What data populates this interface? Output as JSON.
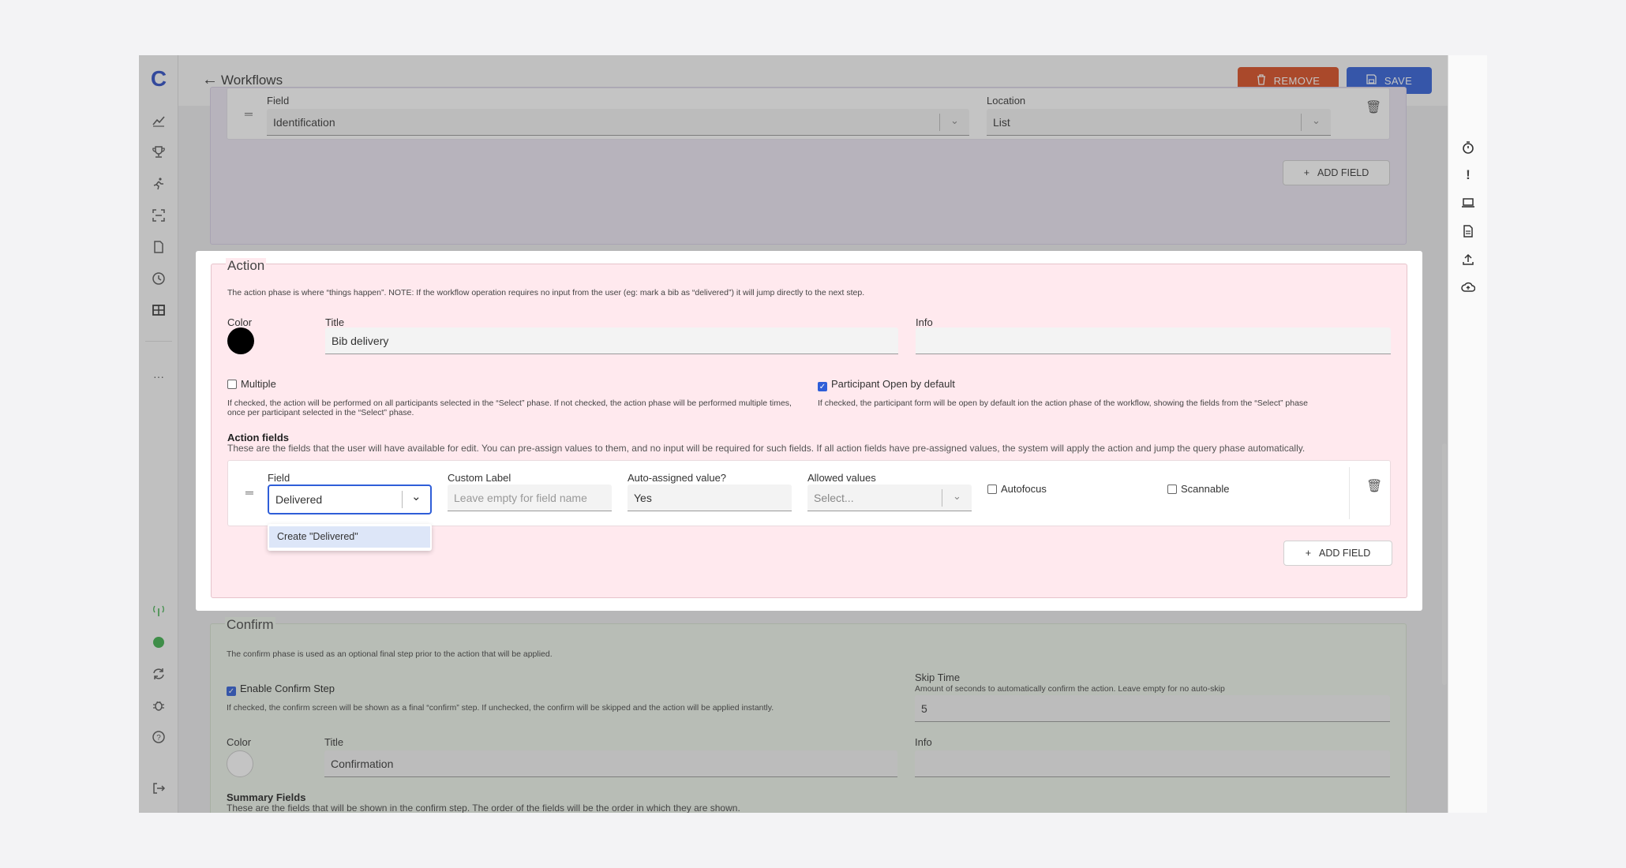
{
  "header": {
    "title": "Workflows",
    "remove_label": "REMOVE",
    "save_label": "SAVE"
  },
  "nav": {
    "logo": "C",
    "more": "···"
  },
  "select_phase": {
    "field_label": "Field",
    "field_value": "Identification",
    "location_label": "Location",
    "location_value": "List",
    "add_field_label": "ADD FIELD"
  },
  "action": {
    "legend": "Action",
    "description": "The action phase is where “things happen”. NOTE: If the workflow operation requires no input from the user (eg: mark a bib as “delivered”) it will jump directly to the next step.",
    "color_label": "Color",
    "color_value": "#000000",
    "title_label": "Title",
    "title_value": "Bib delivery",
    "info_label": "Info",
    "info_value": "",
    "multiple_label": "Multiple",
    "multiple_checked": false,
    "multiple_help": "If checked, the action will be performed on all participants selected in the “Select” phase. If not checked, the action phase will be performed multiple times, once per participant selected in the “Select” phase.",
    "participant_label": "Participant Open by default",
    "participant_checked": true,
    "participant_help": "If checked, the participant form will be open by default ion the action phase of the workflow, showing the fields from the “Select” phase",
    "fields_heading": "Action fields",
    "fields_help": "These are the fields that the user will have available for edit. You can pre-assign values to them, and no input will be required for such fields. If all action fields have pre-assigned values, the system will apply the action and jump the query phase automatically.",
    "row": {
      "field_label": "Field",
      "field_value": "Delivered",
      "custom_label": "Custom Label",
      "custom_placeholder": "Leave empty for field name",
      "auto_label": "Auto-assigned value?",
      "auto_value": "Yes",
      "allowed_label": "Allowed values",
      "allowed_placeholder": "Select...",
      "autofocus_label": "Autofocus",
      "scannable_label": "Scannable"
    },
    "dropdown_option": "Create \"Delivered\"",
    "add_field_label": "ADD FIELD"
  },
  "confirm": {
    "legend": "Confirm",
    "description": "The confirm phase is used as an optional final step prior to the action that will be applied.",
    "enable_label": "Enable Confirm Step",
    "enable_checked": true,
    "enable_help": "If checked, the confirm screen will be shown as a final “confirm” step. If unchecked, the confirm will be skipped and the action will be applied instantly.",
    "skip_label": "Skip Time",
    "skip_help": "Amount of seconds to automatically confirm the action. Leave empty for no auto-skip",
    "skip_value": "5",
    "color_label": "Color",
    "title_label": "Title",
    "title_value": "Confirmation",
    "info_label": "Info",
    "summary_heading": "Summary Fields",
    "summary_help": "These are the fields that will be shown in the confirm step. The order of the fields will be the order in which they are shown."
  },
  "colors": {
    "select_bg": "#ece6f4",
    "action_bg": "#ffe9ee",
    "confirm_bg": "#eef5ea",
    "remove": "#d94a1e",
    "save": "#2f5ed8",
    "status": "#3cb04a"
  }
}
